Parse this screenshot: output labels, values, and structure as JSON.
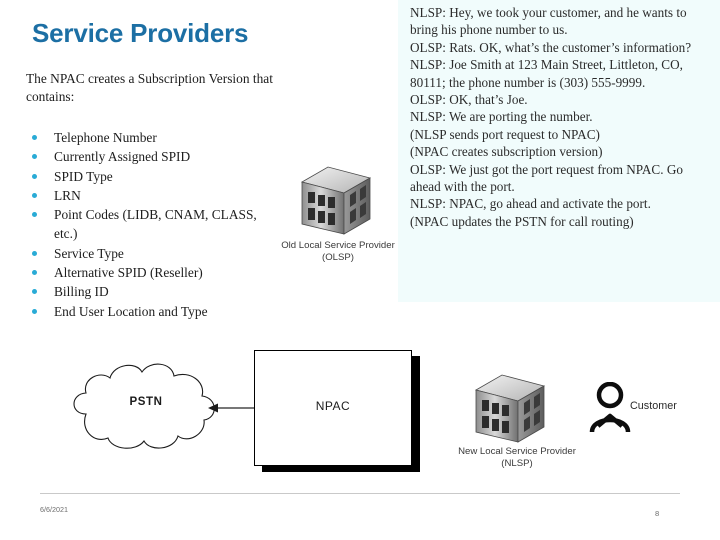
{
  "slide": {
    "title": "Service Providers",
    "title_color": "#1c6fa4",
    "bullet_color": "#29abd6",
    "panel_tint": "#f1fcfc",
    "intro": "The NPAC creates a Subscription Version that contains:",
    "bullets": [
      "Telephone Number",
      "Currently Assigned SPID",
      "SPID Type",
      "LRN",
      "Point Codes (LIDB, CNAM, CLASS, etc.)",
      "Service Type",
      "Alternative SPID (Reseller)",
      "Billing ID",
      "End User Location and Type"
    ]
  },
  "dialogue": {
    "lines": [
      "NLSP: Hey, we took your customer, and he wants to bring his phone number to us.",
      "OLSP: Rats. OK, what’s the customer’s information?",
      "NLSP: Joe Smith at 123 Main Street, Littleton, CO, 80111; the phone number is (303) 555-9999.",
      "OLSP: OK, that’s Joe.",
      "NLSP: We are porting the number.",
      "(NLSP sends port request to NPAC)",
      "(NPAC creates subscription version)",
      "OLSP: We just got the port request from NPAC. Go ahead with the port.",
      "NLSP: NPAC, go ahead and activate the port.",
      "(NPAC updates the PSTN for call routing)"
    ]
  },
  "diagram": {
    "olsp": {
      "icon": "building-icon",
      "caption_line1": "Old Local Service Provider",
      "caption_line2": "(OLSP)"
    },
    "nlsp": {
      "icon": "building-icon",
      "caption_line1": "New Local Service Provider",
      "caption_line2": "(NLSP)"
    },
    "pstn": {
      "icon": "cloud-icon",
      "label": "PSTN"
    },
    "npac": {
      "label": "NPAC"
    },
    "customer": {
      "icon": "person-icon",
      "label": "Customer"
    },
    "arrow": {
      "icon": "arrow-left-icon",
      "from": "NPAC",
      "to": "PSTN"
    }
  },
  "footer": {
    "date": "6/6/2021",
    "page_number": "8"
  }
}
